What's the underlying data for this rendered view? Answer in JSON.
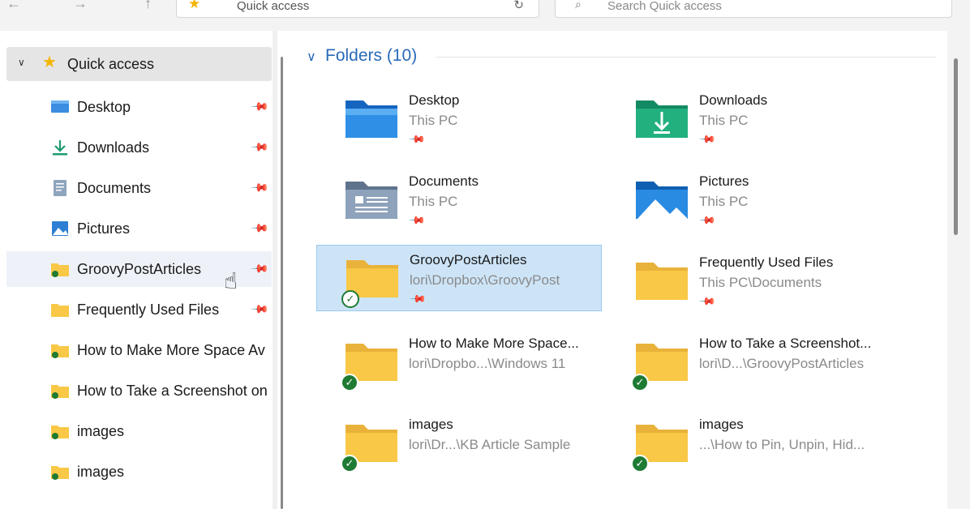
{
  "address_bar": {
    "location": "Quick access"
  },
  "search": {
    "placeholder": "Search Quick access"
  },
  "nav": {
    "header": "Quick access",
    "items": [
      {
        "label": "Desktop",
        "icon": "desktop-icon",
        "pinned": true
      },
      {
        "label": "Downloads",
        "icon": "downloads-icon",
        "pinned": true
      },
      {
        "label": "Documents",
        "icon": "documents-icon",
        "pinned": true
      },
      {
        "label": "Pictures",
        "icon": "pictures-icon",
        "pinned": true
      },
      {
        "label": "GroovyPostArticles",
        "icon": "synced-folder-icon",
        "pinned": true
      },
      {
        "label": "Frequently Used Files",
        "icon": "folder-icon",
        "pinned": true
      },
      {
        "label": "How to Make More Space Av",
        "icon": "synced-folder-icon",
        "pinned": false
      },
      {
        "label": "How to Take a Screenshot on",
        "icon": "synced-folder-icon",
        "pinned": false
      },
      {
        "label": "images",
        "icon": "synced-folder-icon",
        "pinned": false
      },
      {
        "label": "images",
        "icon": "synced-folder-icon",
        "pinned": false
      }
    ]
  },
  "folders": {
    "title": "Folders (10)",
    "items": [
      {
        "name": "Desktop",
        "path": "This PC",
        "icon": "desktop-folder-icon"
      },
      {
        "name": "Downloads",
        "path": "This PC",
        "icon": "downloads-folder-icon"
      },
      {
        "name": "Documents",
        "path": "This PC",
        "icon": "documents-folder-icon"
      },
      {
        "name": "Pictures",
        "path": "This PC",
        "icon": "pictures-folder-icon"
      },
      {
        "name": "GroovyPostArticles",
        "path": "lori\\Dropbox\\GroovyPost",
        "icon": "folder-icon",
        "sync": "available"
      },
      {
        "name": "Frequently Used Files",
        "path": "This PC\\Documents",
        "icon": "folder-icon"
      },
      {
        "name": "How to Make More Space...",
        "path": "lori\\Dropbo...\\Windows 11",
        "icon": "folder-icon",
        "sync": "synced"
      },
      {
        "name": "How to Take a Screenshot...",
        "path": "lori\\D...\\GroovyPostArticles",
        "icon": "folder-icon",
        "sync": "synced"
      },
      {
        "name": "images",
        "path": "lori\\Dr...\\KB Article Sample",
        "icon": "folder-icon",
        "sync": "synced"
      },
      {
        "name": "images",
        "path": "...\\How to Pin, Unpin, Hid...",
        "icon": "folder-icon",
        "sync": "synced"
      }
    ]
  },
  "colors": {
    "accent": "#2a6ab8",
    "folder": "#f8c846",
    "sync_green": "#1e7b33",
    "selection": "#cde4f7"
  }
}
